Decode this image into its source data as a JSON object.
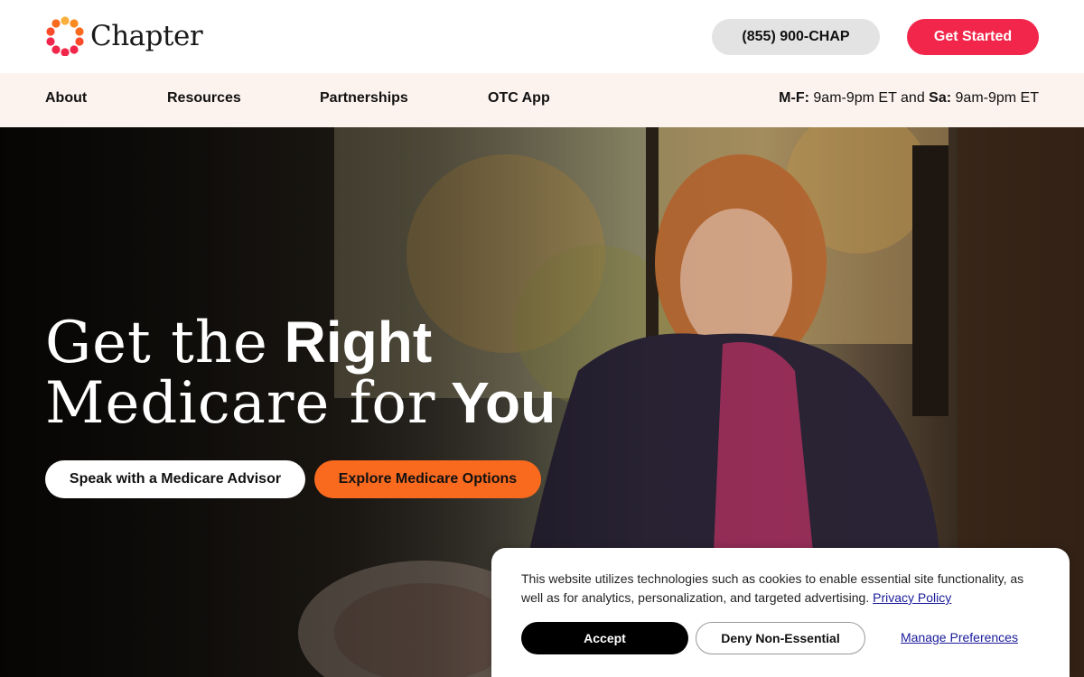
{
  "brand": {
    "name": "Chapter",
    "logo_colors": [
      "#f2264a",
      "#f96a1f",
      "#fbb03b"
    ]
  },
  "header": {
    "phone": "(855) 900-CHAP",
    "cta": "Get Started"
  },
  "nav": {
    "items": [
      "About",
      "Resources",
      "Partnerships",
      "OTC App"
    ],
    "hours": {
      "wd_label": "M-F:",
      "wd_time": "9am-9pm ET and",
      "sa_label": "Sa:",
      "sa_time": "9am-9pm ET"
    }
  },
  "hero": {
    "line1_light": "Get the",
    "line1_bold": "Right",
    "line2_light": "Medicare for",
    "line2_bold": "You",
    "btn_advisor": "Speak with a Medicare Advisor",
    "btn_explore": "Explore Medicare Options"
  },
  "cookie": {
    "text": "This website utilizes technologies such as cookies to enable essential site functionality, as well as for analytics, personalization, and targeted advertising.",
    "privacy_link": "Privacy Policy",
    "accept": "Accept",
    "deny": "Deny Non-Essential",
    "manage": "Manage Preferences"
  },
  "colors": {
    "primary": "#f2264a",
    "secondary": "#f96a1f",
    "nav_bg": "#fcf2ee"
  }
}
